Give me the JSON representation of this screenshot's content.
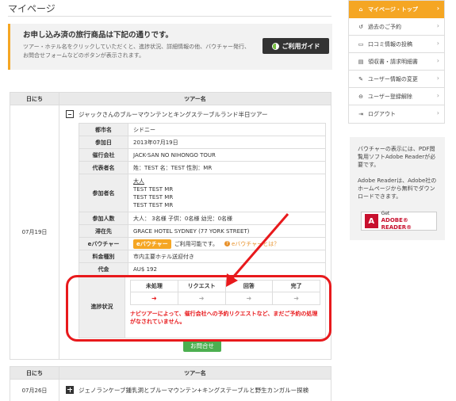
{
  "page": {
    "title": "マイページ"
  },
  "info": {
    "heading": "お申し込み済の旅行商品は下記の通りです。",
    "text": "ツアー・ホテル名をクリックしていただくと、進捗状況、詳細情報の他、バウチャー発行、お問合せフォームなどのボタンが表示されます。",
    "guide_button": "ご利用ガイド"
  },
  "table": {
    "col_date": "日にち",
    "col_tour": "ツアー名",
    "date": "07月19日",
    "tour_name": "ジャックさんのブルーマウンテンとキングステーブルランド半日ツアー",
    "details": [
      {
        "label": "都市名",
        "value": "シドニー"
      },
      {
        "label": "参加日",
        "value": "2013年07月19日"
      },
      {
        "label": "催行会社",
        "value": "JACK-SAN NO NIHONGO TOUR"
      },
      {
        "label": "代表者名",
        "value": "姓：TEST 名：TEST 性別：MR"
      },
      {
        "label": "参加者名",
        "value_lines": [
          "大人",
          "TEST TEST MR",
          "TEST TEST MR",
          "TEST TEST MR"
        ]
      },
      {
        "label": "参加人数",
        "value": "大人： 3名様 子供：0名様 幼児：0名様"
      },
      {
        "label": "滞在先",
        "value": "GRACE HOTEL SYDNEY (77 YORK STREET)"
      },
      {
        "label": "eバウチャー",
        "button": "eバウチャー",
        "value": "ご利用可能です。",
        "link": "eバウチャーとは？"
      },
      {
        "label": "料金種別",
        "value": "市内主要ホテル送迎付き"
      },
      {
        "label": "代金",
        "value": "AU$ 192"
      }
    ],
    "progress": {
      "label": "進捗状況",
      "steps": [
        "未処理",
        "リクエスト",
        "回答",
        "完了"
      ],
      "current_step": 1,
      "note": "ナビツアーによって、催行会社への予約リクエストなど、まだご予約の処理がなされていません。"
    },
    "inquiry_button": "お問合せ"
  },
  "table2": {
    "col_date": "日にち",
    "col_tour": "ツアー名",
    "date": "07月26日",
    "tour_name": "ジェノランケーブ鍾乳洞とブルーマウンテン+キングステーブルと野生カンガルー探検"
  },
  "sidebar": {
    "items": [
      {
        "label": "マイページ・トップ",
        "icon": "home-icon",
        "active": true
      },
      {
        "label": "過去のご予約",
        "icon": "history-icon"
      },
      {
        "label": "口コミ情報の投稿",
        "icon": "comment-icon"
      },
      {
        "label": "領収書・請求明細書",
        "icon": "receipt-icon"
      },
      {
        "label": "ユーザー情報の変更",
        "icon": "wrench-icon"
      },
      {
        "label": "ユーザー登録解除",
        "icon": "remove-icon"
      },
      {
        "label": "ログアウト",
        "icon": "logout-icon"
      }
    ]
  },
  "reader": {
    "text1": "バウチャーの表示には、PDF閲覧用ソフトAdobe Readerが必要です。",
    "text2": "Adobe Readerは、Adobe社のホームページから無料でダウンロードできます。",
    "button_get": "Get",
    "button_name": "ADOBE® READER®"
  },
  "colors": {
    "accent": "#f5a623",
    "highlight": "#e8191c",
    "inquiry": "#4caf50"
  }
}
